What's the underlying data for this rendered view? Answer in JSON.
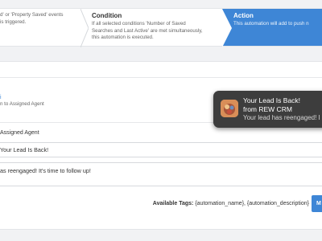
{
  "steps": {
    "trigger": {
      "title": "",
      "desc_line1": "d' or 'Property Saved' events",
      "desc_line2": "is triggered."
    },
    "condition": {
      "title": "Condition",
      "desc_line1": "If all selected conditions 'Number of Saved",
      "desc_line2": "Searches and Last Active' are met simultaneously,",
      "desc_line3": "this automation is executed."
    },
    "action": {
      "title": "Action",
      "desc_line1": "This automation will add to push n"
    }
  },
  "form": {
    "blue_mark": "i",
    "sub_label": "n to Assigned Agent",
    "field_label": "Assigned Agent",
    "subject_value": "Your Lead Is Back!",
    "body_value": "as reengaged! It's time to follow up!",
    "tags_label": "Available Tags:",
    "tags_value": "{automation_name}, {automation_description}",
    "insert_button": "M"
  },
  "notification": {
    "title": "Your Lead Is Back!",
    "from": "from REW CRM",
    "message": "Your lead has reengaged! I"
  },
  "colors": {
    "accent": "#3e86d6",
    "notification_bg": "#3d3d3d"
  }
}
